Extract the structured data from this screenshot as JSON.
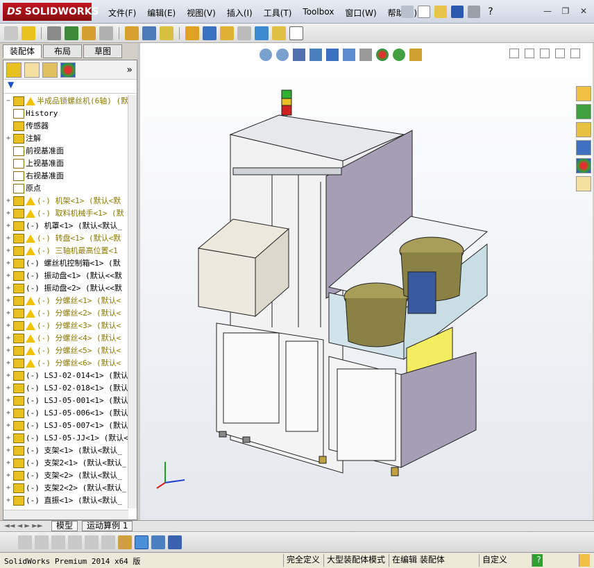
{
  "app": {
    "logo_text": "SOLIDWORKS",
    "logo_prefix": "DS"
  },
  "menu": [
    "文件(F)",
    "编辑(E)",
    "视图(V)",
    "插入(I)",
    "工具(T)",
    "Toolbox",
    "窗口(W)",
    "帮助(H)"
  ],
  "left_tabs": [
    "装配体",
    "布局",
    "草图"
  ],
  "tree": {
    "root": "半成品锁螺丝机(6轴)  (默",
    "items": [
      {
        "label": "History",
        "icon": "history-icon",
        "warn": false,
        "expand": false
      },
      {
        "label": "传感器",
        "icon": "sensor-icon",
        "warn": false,
        "expand": false
      },
      {
        "label": "注解",
        "icon": "annotation-icon",
        "warn": false,
        "expand": true
      },
      {
        "label": "前视基准面",
        "icon": "plane-icon",
        "warn": false,
        "expand": false
      },
      {
        "label": "上视基准面",
        "icon": "plane-icon",
        "warn": false,
        "expand": false
      },
      {
        "label": "右视基准面",
        "icon": "plane-icon",
        "warn": false,
        "expand": false
      },
      {
        "label": "原点",
        "icon": "origin-icon",
        "warn": false,
        "expand": false
      },
      {
        "label": "(-) 机架<1> (默认<默",
        "icon": "assembly-icon",
        "warn": true,
        "expand": true
      },
      {
        "label": "(-) 取料机械手<1> (默",
        "icon": "assembly-icon",
        "warn": true,
        "expand": true
      },
      {
        "label": "(-) 机罩<1> (默认<默认_",
        "icon": "assembly-icon",
        "warn": false,
        "expand": true
      },
      {
        "label": "(-) 转盘<1> (默认<默",
        "icon": "assembly-icon",
        "warn": true,
        "expand": true
      },
      {
        "label": "(-) 三轴机最高位置<1",
        "icon": "assembly-icon",
        "warn": true,
        "expand": true
      },
      {
        "label": "(-) 螺丝机控制箱<1> (默",
        "icon": "assembly-icon",
        "warn": false,
        "expand": true
      },
      {
        "label": "(-) 振动盘<1> (默认<<默",
        "icon": "assembly-icon",
        "warn": false,
        "expand": true
      },
      {
        "label": "(-) 振动盘<2> (默认<<默",
        "icon": "assembly-icon",
        "warn": false,
        "expand": true
      },
      {
        "label": "(-) 分螺丝<1> (默认<",
        "icon": "assembly-icon",
        "warn": true,
        "expand": true
      },
      {
        "label": "(-) 分螺丝<2> (默认<",
        "icon": "assembly-icon",
        "warn": true,
        "expand": true
      },
      {
        "label": "(-) 分螺丝<3> (默认<",
        "icon": "assembly-icon",
        "warn": true,
        "expand": true
      },
      {
        "label": "(-) 分螺丝<4> (默认<",
        "icon": "assembly-icon",
        "warn": true,
        "expand": true
      },
      {
        "label": "(-) 分螺丝<5> (默认<",
        "icon": "assembly-icon",
        "warn": true,
        "expand": true
      },
      {
        "label": "(-) 分螺丝<6> (默认<",
        "icon": "assembly-icon",
        "warn": true,
        "expand": true
      },
      {
        "label": "(-) LSJ-02-014<1> (默认",
        "icon": "assembly-icon",
        "warn": false,
        "expand": true
      },
      {
        "label": "(-) LSJ-02-018<1> (默认",
        "icon": "assembly-icon",
        "warn": false,
        "expand": true
      },
      {
        "label": "(-) LSJ-05-001<1> (默认",
        "icon": "assembly-icon",
        "warn": false,
        "expand": true
      },
      {
        "label": "(-) LSJ-05-006<1> (默认",
        "icon": "assembly-icon",
        "warn": false,
        "expand": true
      },
      {
        "label": "(-) LSJ-05-007<1> (默认",
        "icon": "assembly-icon",
        "warn": false,
        "expand": true
      },
      {
        "label": "(-) LSJ-05-JJ<1> (默认<",
        "icon": "assembly-icon",
        "warn": false,
        "expand": true
      },
      {
        "label": "(-) 支架<1> (默认<默认_",
        "icon": "assembly-icon",
        "warn": false,
        "expand": true
      },
      {
        "label": "(-) 支架2<1> (默认<默认_",
        "icon": "assembly-icon",
        "warn": false,
        "expand": true
      },
      {
        "label": "(-) 支架<2> (默认<默认_",
        "icon": "assembly-icon",
        "warn": false,
        "expand": true
      },
      {
        "label": "(-) 支架2<2> (默认<默认_",
        "icon": "assembly-icon",
        "warn": false,
        "expand": true
      },
      {
        "label": "(-) 直振<1> (默认<默认_",
        "icon": "assembly-icon",
        "warn": false,
        "expand": true
      }
    ]
  },
  "bottom_tabs": [
    "模型",
    "运动算例 1"
  ],
  "status": {
    "version": "SolidWorks Premium 2014 x64 版",
    "fully_defined": "完全定义",
    "large_assembly": "大型装配体模式",
    "editing": "在编辑 装配体",
    "custom": "自定义"
  },
  "colors": {
    "logo_red": "#b0141c",
    "warn_yellow": "#f2c200",
    "icon_yellow": "#e8c020",
    "viewport_bg": "#f4f6f9"
  }
}
